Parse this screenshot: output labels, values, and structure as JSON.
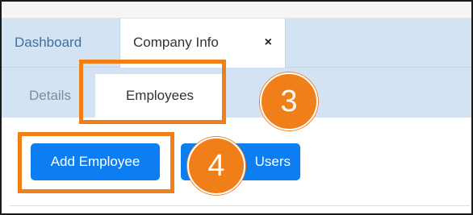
{
  "tabs": {
    "dashboard_label": "Dashboard",
    "company_info_label": "Company Info",
    "close_glyph": "×"
  },
  "subtabs": {
    "details_label": "Details",
    "employees_label": "Employees"
  },
  "toolbar": {
    "add_employee_label": "Add Employee",
    "users_label": "Users"
  },
  "annotations": {
    "step_3": "3",
    "step_4": "4"
  },
  "colors": {
    "accent": "#0d7ef2",
    "highlight": "#f07f1a",
    "tab_bar": "#d4e3f3"
  }
}
